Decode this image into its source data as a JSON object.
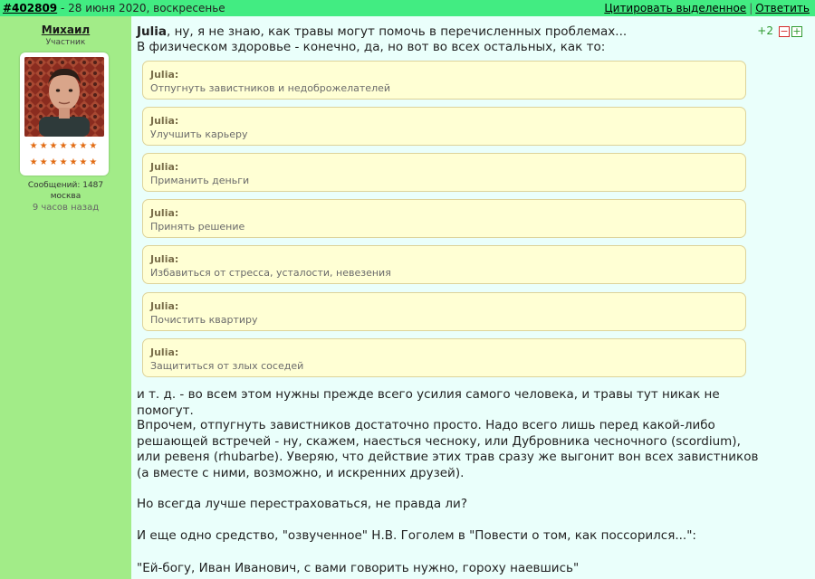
{
  "header": {
    "post_id": "#402809",
    "date": " - 28 июня 2020, воскресенье",
    "quote_selected": "Цитировать выделенное",
    "separator": "|",
    "reply": "Ответить"
  },
  "author": {
    "name": "Михаил",
    "role": "Участник",
    "stars_row1": "★★★★★★★",
    "stars_row2": "★★★★★★★",
    "messages": "Сообщений: 1487",
    "city": "москва",
    "last_seen": "9 часов назад"
  },
  "rating": {
    "score": "+2",
    "minus": "−",
    "plus": "+"
  },
  "post": {
    "addressee": "Julia",
    "intro_line1": ", ну, я не знаю, как травы могут помочь в перечисленных проблемах...",
    "intro_line2": "В физическом здоровье - конечно, да, но вот во всех остальных, как то:",
    "quotes": [
      {
        "author": "Julia:",
        "text": "Отпугнуть завистников и недоброжелателей"
      },
      {
        "author": "Julia:",
        "text": "Улучшить карьеру"
      },
      {
        "author": "Julia:",
        "text": "Приманить деньги"
      },
      {
        "author": "Julia:",
        "text": "Принять решение"
      },
      {
        "author": "Julia:",
        "text": "Избавиться от стресса, усталости, невезения"
      },
      {
        "author": "Julia:",
        "text": "Почистить квартиру"
      },
      {
        "author": "Julia:",
        "text": "Защититься от злых соседей"
      }
    ],
    "paragraphs": [
      "и т. д. - во всем этом нужны прежде всего усилия самого человека, и травы тут никак не помогут.",
      "Впрочем, отпугнуть завистников достаточно просто. Надо всего лишь перед какой-либо решающей встречей - ну, скажем, наесться чесноку, или Дубровника чесночного (scordium), или ревеня (rhubarbe). Уверяю, что действие этих трав сразу же выгонит вон всех завистников (а вместе с ними, возможно, и искренних друзей).",
      "Но всегда лучше перестраховаться, не правда ли?",
      "И еще одно средство, \"озвученное\" Н.В. Гоголем в \"Повести о том, как поссорился...\":",
      "\"Ей-богу, Иван Иванович, с вами говорить нужно, гороху наевшись\""
    ]
  }
}
